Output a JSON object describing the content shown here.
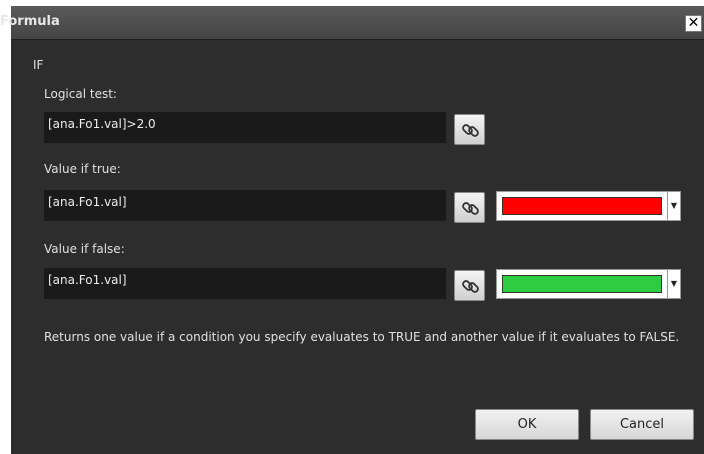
{
  "window": {
    "title": "Formula",
    "close_glyph": "✕"
  },
  "function_name": "IF",
  "logical_test": {
    "label": "Logical test:",
    "value": "[ana.Fo1.val]>2.0"
  },
  "value_if_true": {
    "label": "Value if true:",
    "value": "[ana.Fo1.val]",
    "color": "#ff0000"
  },
  "value_if_false": {
    "label": "Value if false:",
    "value": "[ana.Fo1.val]",
    "color": "#2ecc40"
  },
  "description": "Returns one value if a condition you specify evaluates to TRUE and another value if it evaluates to FALSE.",
  "buttons": {
    "ok": "OK",
    "cancel": "Cancel"
  },
  "icons": {
    "link": "link-icon",
    "dropdown": "chevron-down-icon",
    "close": "close-icon"
  }
}
